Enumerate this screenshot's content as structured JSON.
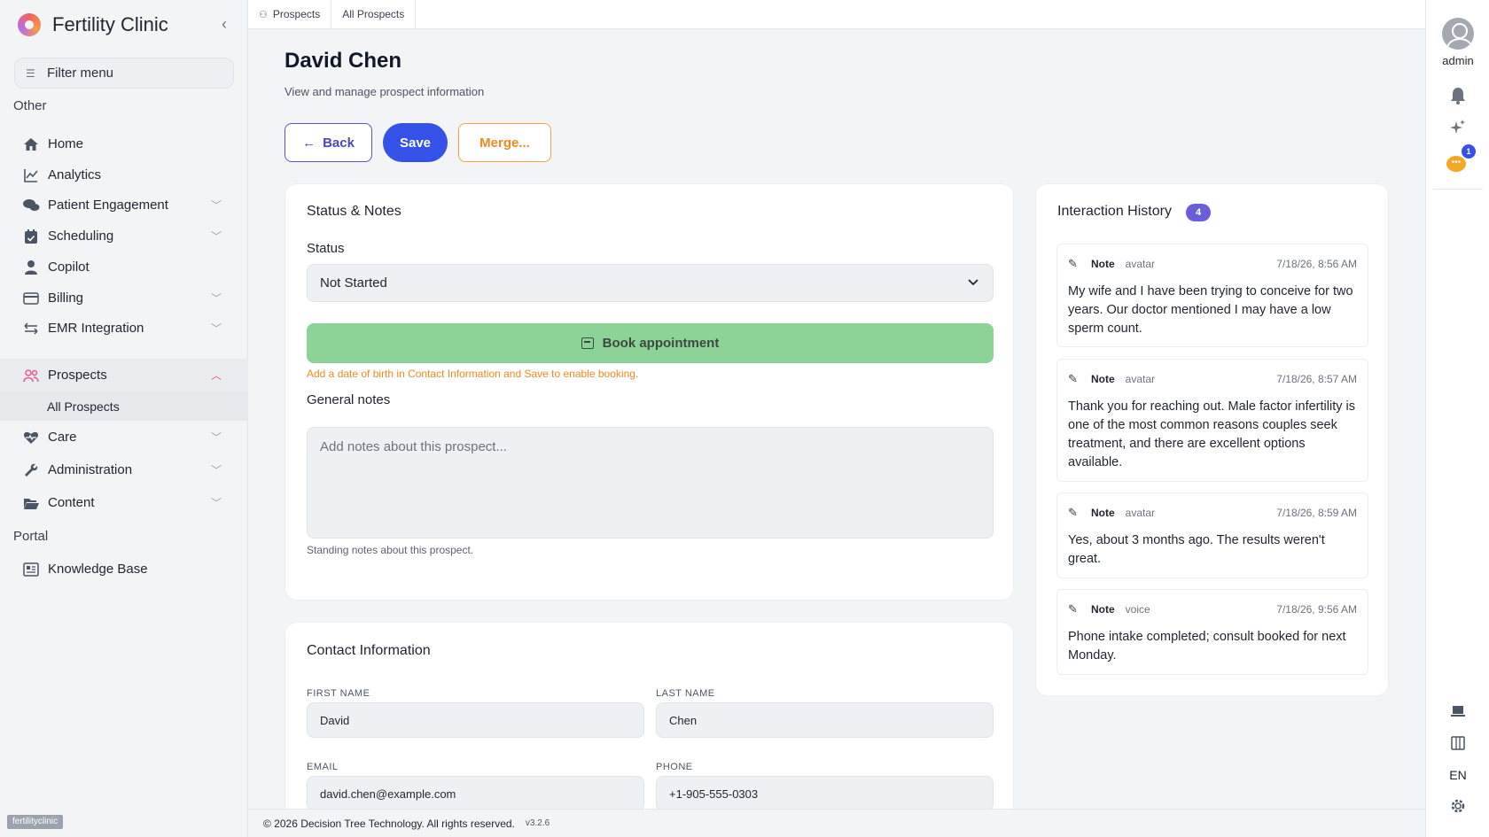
{
  "sidebar": {
    "brand": "Fertility Clinic",
    "filter_placeholder": "Filter menu",
    "sections": {
      "other": "Other",
      "portal": "Portal"
    },
    "items": [
      {
        "label": "Home",
        "icon": "home-icon"
      },
      {
        "label": "Analytics",
        "icon": "chart-line-icon"
      },
      {
        "label": "Patient Engagement",
        "icon": "chat-bubbles-icon"
      },
      {
        "label": "Scheduling",
        "icon": "calendar-check-icon"
      },
      {
        "label": "Copilot",
        "icon": "person-icon"
      },
      {
        "label": "Billing",
        "icon": "credit-card-icon"
      },
      {
        "label": "EMR Integration",
        "icon": "arrows-exchange-icon"
      },
      {
        "label": "Prospects",
        "icon": "users-icon"
      },
      {
        "label": "Care",
        "icon": "heart-pulse-icon"
      },
      {
        "label": "Administration",
        "icon": "wrench-icon"
      },
      {
        "label": "Content",
        "icon": "folder-open-icon"
      }
    ],
    "sub_item": "All Prospects",
    "portal_item": "Knowledge Base",
    "tenant": "fertilityclinic"
  },
  "breadcrumb": {
    "first": "Prospects",
    "second": "All Prospects"
  },
  "page": {
    "title": "David Chen",
    "subtitle": "View and manage prospect information",
    "back_label": "Back",
    "save_label": "Save",
    "merge_label": "Merge..."
  },
  "status_card": {
    "title": "Status & Notes",
    "status_label": "Status",
    "status_value": "Not Started",
    "book_label": "Book appointment",
    "warning": "Add a date of birth in Contact Information and Save to enable booking.",
    "notes_label": "General notes",
    "notes_placeholder": "Add notes about this prospect...",
    "notes_helper": "Standing notes about this prospect."
  },
  "contact_card": {
    "title": "Contact Information",
    "first_name_label": "FIRST NAME",
    "first_name": "David",
    "last_name_label": "LAST NAME",
    "last_name": "Chen",
    "email_label": "EMAIL",
    "email": "david.chen@example.com",
    "phone_label": "PHONE",
    "phone": "+1-905-555-0303"
  },
  "history": {
    "title": "Interaction History",
    "count": "4",
    "entries": [
      {
        "type": "Note",
        "source": "avatar",
        "time": "7/18/26, 8:56 AM",
        "text": "My wife and I have been trying to conceive for two years. Our doctor mentioned I may have a low sperm count."
      },
      {
        "type": "Note",
        "source": "avatar",
        "time": "7/18/26, 8:57 AM",
        "text": "Thank you for reaching out. Male factor infertility is one of the most common reasons couples seek treatment, and there are excellent options available."
      },
      {
        "type": "Note",
        "source": "avatar",
        "time": "7/18/26, 8:59 AM",
        "text": "Yes, about 3 months ago. The results weren't great."
      },
      {
        "type": "Note",
        "source": "voice",
        "time": "7/18/26, 9:56 AM",
        "text": "Phone intake completed; consult booked for next Monday."
      }
    ]
  },
  "footer": {
    "copyright": "© 2026 Decision Tree Technology. All rights reserved.",
    "version": "v3.2.6"
  },
  "rail": {
    "user": "admin",
    "chat_badge": "1",
    "language": "EN"
  },
  "colors": {
    "primary": "#3451e8",
    "accent_purple": "#6a5fd6",
    "warning": "#ef8a1f",
    "success": "#8dd398",
    "prospects_accent": "#e75a8b"
  }
}
